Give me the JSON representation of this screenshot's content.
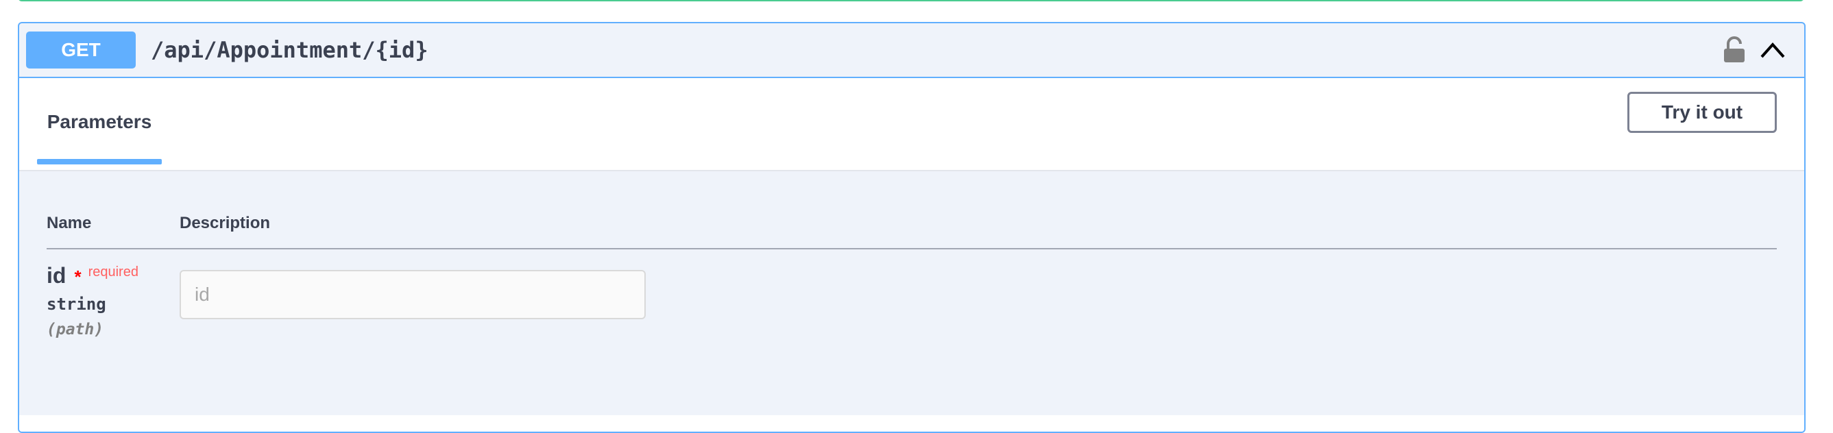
{
  "endpoint": {
    "method": "GET",
    "path": "/api/Appointment/{id}",
    "colors": {
      "accent": "#61affe",
      "required": "#ff0000"
    }
  },
  "parameters": {
    "tab_label": "Parameters",
    "try_button_label": "Try it out",
    "columns": {
      "name": "Name",
      "description": "Description"
    },
    "items": [
      {
        "name": "id",
        "required_star": "*",
        "required_label": "required",
        "type": "string",
        "in": "(path)",
        "placeholder": "id"
      }
    ]
  },
  "icons": {
    "lock": "lock-icon",
    "collapse": "chevron-up-icon"
  }
}
